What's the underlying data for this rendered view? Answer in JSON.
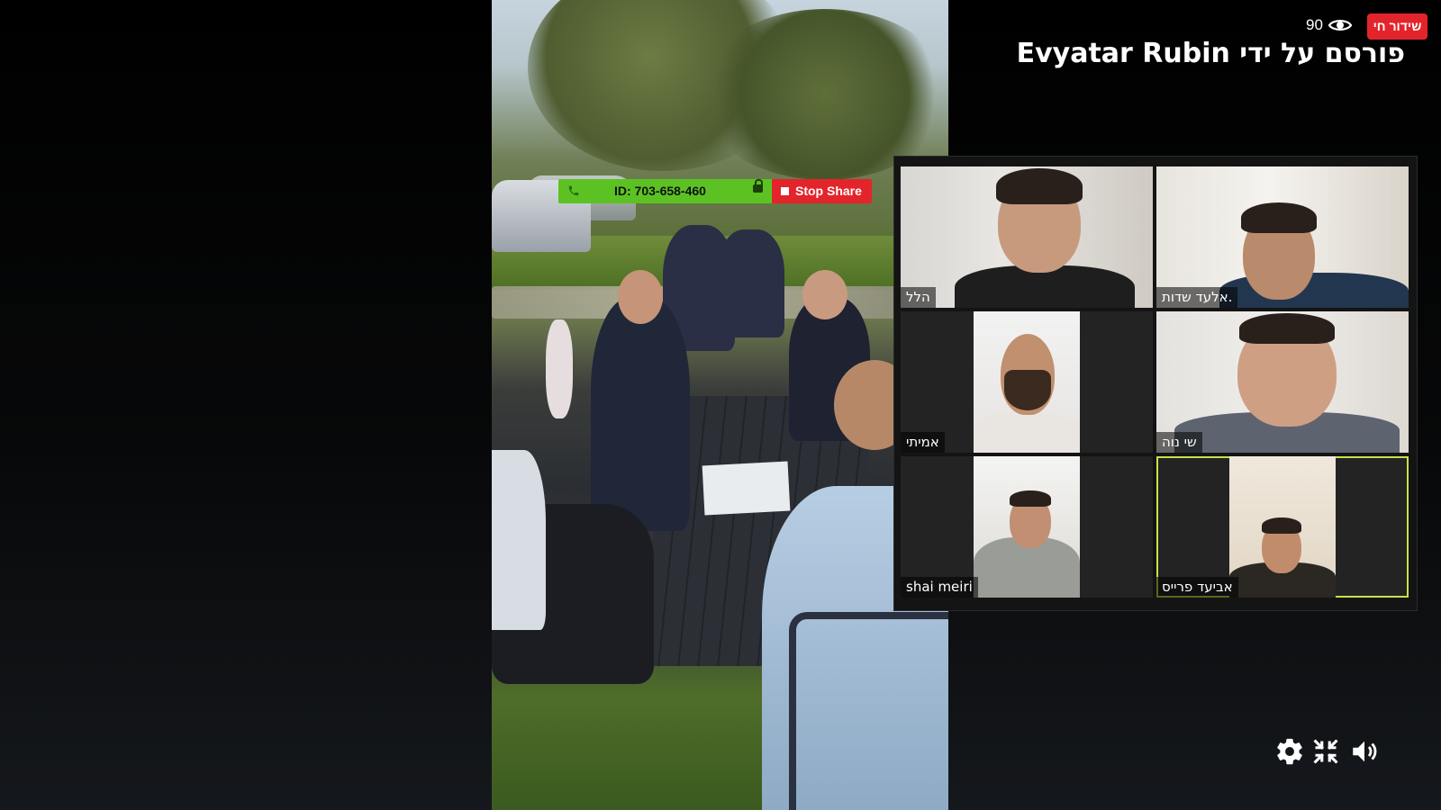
{
  "header": {
    "live_badge": "שידור חי",
    "viewer_count": "90",
    "posted_by": "פורסם על ידי Evyatar Rubin"
  },
  "meeting": {
    "meeting_id": "ID: 703-658-460",
    "stop_share_label": "Stop Share"
  },
  "participants": [
    {
      "name": "הלל"
    },
    {
      "name": "אלעד שדות."
    },
    {
      "name": "אמיתי"
    },
    {
      "name": "שי נוה"
    },
    {
      "name": "shai meiri"
    },
    {
      "name": "אביעד פרייס"
    }
  ],
  "active_speaker_index": 5,
  "controls": {
    "settings_icon": "gear-icon",
    "exit_fullscreen_icon": "compress-icon",
    "volume_icon": "volume-icon"
  },
  "colors": {
    "live_red": "#e3242b",
    "meeting_green": "#5cc224",
    "active_speaker_outline": "#c6e34a"
  }
}
